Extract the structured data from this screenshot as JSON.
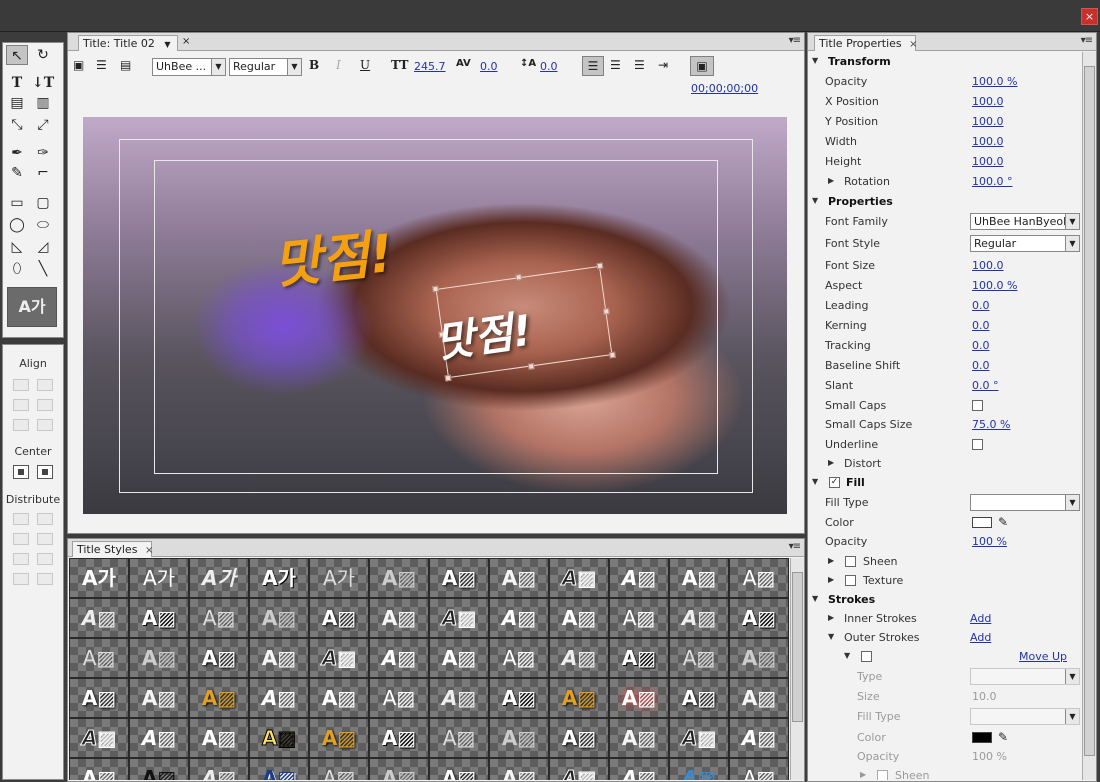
{
  "app": {
    "close_glyph": "×"
  },
  "title_panel": {
    "tab_label": "Title: Title 02",
    "font_family": "UhBee ...",
    "font_style": "Regular",
    "bold": "B",
    "italic": "I",
    "underline": "U",
    "font_size": "245.7",
    "kerning": "0.0",
    "leading": "0.0",
    "timecode": "00;00;00;00",
    "overlay_text_1": "맛점!",
    "overlay_text_2": "맛점!"
  },
  "tools": {
    "preview_text": "A가"
  },
  "align_panel": {
    "align_label": "Align",
    "center_label": "Center",
    "distribute_label": "Distribute"
  },
  "styles_panel": {
    "tab_label": "Title Styles",
    "swatches": [
      "A가",
      "A가",
      "A가",
      "A가",
      "A가",
      "A▨",
      "A▨",
      "A▨",
      "A▨",
      "A▨",
      "A▨",
      "A▨",
      "A▨",
      "A▨",
      "A▨",
      "A▨",
      "A▨",
      "A▨",
      "A▨",
      "A▨",
      "A▨",
      "A▨",
      "A▨",
      "A▨",
      "A▨",
      "A▨",
      "A▨",
      "A▨",
      "A▨",
      "A▨",
      "A▨",
      "A▨",
      "A▨",
      "A▨",
      "A▨",
      "A▨",
      "A▨",
      "A▨",
      "A▨",
      "A▨",
      "A▨",
      "A▨",
      "A▨",
      "A▨",
      "A▨",
      "A▨",
      "A▨",
      "A▨",
      "A▨",
      "A▨",
      "A▨",
      "A▨",
      "A▨",
      "A▨",
      "A▨",
      "A▨",
      "A▨",
      "A▨",
      "A▨",
      "A▨",
      "A▨",
      "A▨",
      "A▨",
      "A▨",
      "A▨",
      "A▨",
      "A▨",
      "A▨",
      "A▨",
      "A▨",
      "A▨",
      "A▨"
    ]
  },
  "props": {
    "tab_label": "Title Properties",
    "transform": "Transform",
    "opacity_label": "Opacity",
    "opacity_value": "100.0",
    "opacity_unit": "%",
    "xpos_label": "X Position",
    "xpos_value": "100.0",
    "ypos_label": "Y Position",
    "ypos_value": "100.0",
    "width_label": "Width",
    "width_value": "100.0",
    "height_label": "Height",
    "height_value": "100.0",
    "rotation_label": "Rotation",
    "rotation_value": "100.0",
    "rotation_unit": "°",
    "properties": "Properties",
    "font_family_label": "Font Family",
    "font_family_value": "UhBee HanByeol",
    "font_style_label": "Font Style",
    "font_style_value": "Regular",
    "font_size_label": "Font Size",
    "font_size_value": "100.0",
    "aspect_label": "Aspect",
    "aspect_value": "100.0",
    "aspect_unit": "%",
    "leading_label": "Leading",
    "leading_value": "0.0",
    "kerning_label": "Kerning",
    "kerning_value": "0.0",
    "tracking_label": "Tracking",
    "tracking_value": "0.0",
    "baseline_label": "Baseline Shift",
    "baseline_value": "0.0",
    "slant_label": "Slant",
    "slant_value": "0.0",
    "slant_unit": "°",
    "smallcaps_label": "Small Caps",
    "smallcaps_size_label": "Small Caps Size",
    "smallcaps_size_value": "75.0",
    "smallcaps_size_unit": "%",
    "underline_label": "Underline",
    "distort_label": "Distort",
    "fill": "Fill",
    "fill_type_label": "Fill Type",
    "color_label": "Color",
    "fill_opacity_label": "Opacity",
    "fill_opacity_value": "100",
    "fill_opacity_unit": "%",
    "sheen_label": "Sheen",
    "texture_label": "Texture",
    "strokes": "Strokes",
    "inner_label": "Inner Strokes",
    "inner_add": "Add",
    "outer_label": "Outer Strokes",
    "outer_add": "Add",
    "move_up": "Move Up",
    "type_label": "Type",
    "size_label": "Size",
    "size_value": "10.0",
    "stroke_fill_type_label": "Fill Type",
    "stroke_color_label": "Color",
    "stroke_opacity_label": "Opacity",
    "stroke_opacity_value": "100",
    "stroke_opacity_unit": "%",
    "stroke_sheen_label": "Sheen",
    "fill_color": "#ffffff",
    "stroke_color": "#000000"
  }
}
